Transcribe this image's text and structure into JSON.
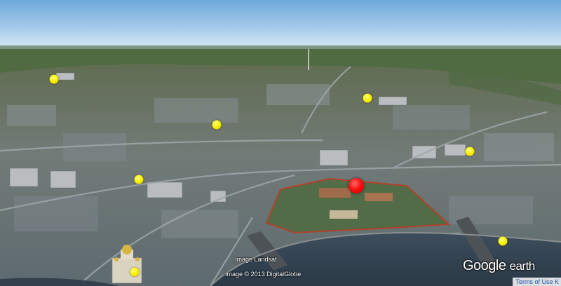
{
  "map": {
    "view": "3d-oblique-aerial",
    "markers": [
      {
        "name": "marker-yellow-1",
        "color": "#fff200"
      },
      {
        "name": "marker-yellow-2",
        "color": "#fff200"
      },
      {
        "name": "marker-yellow-3",
        "color": "#fff200"
      },
      {
        "name": "marker-yellow-4",
        "color": "#fff200"
      },
      {
        "name": "marker-yellow-5",
        "color": "#fff200"
      },
      {
        "name": "marker-yellow-6",
        "color": "#fff200"
      },
      {
        "name": "marker-yellow-7",
        "color": "#fff200"
      },
      {
        "name": "marker-red-center",
        "color": "#ff1010"
      }
    ]
  },
  "credits": {
    "line1": "Image Landsat",
    "line2": "Image © 2013 DigitalGlobe"
  },
  "logo": {
    "word1": "Google",
    "word2": "earth"
  },
  "terms": {
    "label": "Terms of Use",
    "suffix": "K"
  }
}
